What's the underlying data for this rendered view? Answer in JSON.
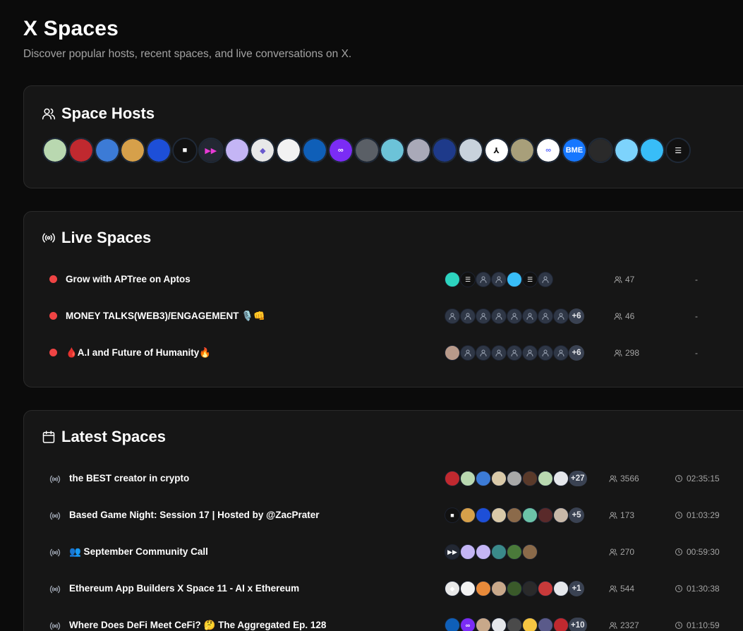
{
  "header": {
    "title": "X Spaces",
    "subtitle": "Discover popular hosts, recent spaces, and live conversations on X."
  },
  "hosts": {
    "title": "Space Hosts",
    "avatars": [
      {
        "bg": "#b9d8b0",
        "fg": "#4a3b2a",
        "glyph": ""
      },
      {
        "bg": "#c0292f",
        "fg": "#ffffff",
        "glyph": ""
      },
      {
        "bg": "#3c7bd6",
        "fg": "#f5c542",
        "glyph": ""
      },
      {
        "bg": "#d6a04a",
        "fg": "#3b2a1a",
        "glyph": ""
      },
      {
        "bg": "#1d4fd8",
        "fg": "#ffffff",
        "glyph": ""
      },
      {
        "bg": "#111111",
        "fg": "#ffffff",
        "glyph": "■"
      },
      {
        "bg": "#232833",
        "fg": "#e83ad6",
        "glyph": "▶▶"
      },
      {
        "bg": "#c4b5f5",
        "fg": "#5b3b1f",
        "glyph": ""
      },
      {
        "bg": "#e8e8e8",
        "fg": "#6a5acd",
        "glyph": "◆"
      },
      {
        "bg": "#f2f2f2",
        "fg": "#111111",
        "glyph": ""
      },
      {
        "bg": "#0f5fb8",
        "fg": "#ffffff",
        "glyph": ""
      },
      {
        "bg": "#7b2cf5",
        "fg": "#ffffff",
        "glyph": "∞"
      },
      {
        "bg": "#5a5f66",
        "fg": "#ffffff",
        "glyph": ""
      },
      {
        "bg": "#6cc3d8",
        "fg": "#2a2a2a",
        "glyph": ""
      },
      {
        "bg": "#a9a9b8",
        "fg": "#2a2a2a",
        "glyph": ""
      },
      {
        "bg": "#1e3a8a",
        "fg": "#ffffff",
        "glyph": ""
      },
      {
        "bg": "#c8d2dc",
        "fg": "#2a2a2a",
        "glyph": ""
      },
      {
        "bg": "#ffffff",
        "fg": "#111111",
        "glyph": "⅄"
      },
      {
        "bg": "#a89f7a",
        "fg": "#2a2a2a",
        "glyph": ""
      },
      {
        "bg": "#ffffff",
        "fg": "#5b6cff",
        "glyph": "∞"
      },
      {
        "bg": "#1677ff",
        "fg": "#ffffff",
        "glyph": "BME"
      },
      {
        "bg": "#2a2a2a",
        "fg": "#ffffff",
        "glyph": ""
      },
      {
        "bg": "#7dd3fc",
        "fg": "#111111",
        "glyph": ""
      },
      {
        "bg": "#38bdf8",
        "fg": "#16a34a",
        "glyph": ""
      },
      {
        "bg": "#111111",
        "fg": "#ffffff",
        "glyph": "☰"
      }
    ]
  },
  "live": {
    "title": "Live Spaces",
    "rows": [
      {
        "name": "Grow with APTree on Aptos",
        "listeners": "47",
        "duration": "-",
        "avatars": [
          {
            "bg": "#2dd4bf"
          },
          {
            "bg": "#111111",
            "glyph": "☰"
          },
          {
            "bg": ""
          },
          {
            "bg": ""
          },
          {
            "bg": "#38bdf8"
          },
          {
            "bg": "#111111",
            "glyph": "☰"
          },
          {
            "bg": ""
          }
        ],
        "more": ""
      },
      {
        "name": "MONEY TALKS(WEB3)/ENGAGEMENT 🎙️👊",
        "listeners": "46",
        "duration": "-",
        "avatars": [
          {
            "bg": ""
          },
          {
            "bg": ""
          },
          {
            "bg": ""
          },
          {
            "bg": ""
          },
          {
            "bg": ""
          },
          {
            "bg": ""
          },
          {
            "bg": ""
          },
          {
            "bg": ""
          }
        ],
        "more": "+6"
      },
      {
        "name": "🩸A.I and Future of Humanity🔥",
        "listeners": "298",
        "duration": "-",
        "avatars": [
          {
            "bg": "#b89a8a"
          },
          {
            "bg": ""
          },
          {
            "bg": ""
          },
          {
            "bg": ""
          },
          {
            "bg": ""
          },
          {
            "bg": ""
          },
          {
            "bg": ""
          },
          {
            "bg": ""
          }
        ],
        "more": "+6"
      }
    ]
  },
  "latest": {
    "title": "Latest Spaces",
    "rows": [
      {
        "name": "the BEST creator in crypto",
        "listeners": "3566",
        "duration": "02:35:15",
        "avatars": [
          {
            "bg": "#c0292f"
          },
          {
            "bg": "#b9d8b0"
          },
          {
            "bg": "#3c7bd6"
          },
          {
            "bg": "#d9c9a8"
          },
          {
            "bg": "#a8a8a8"
          },
          {
            "bg": "#5a3a2a"
          },
          {
            "bg": "#b9d8b0"
          },
          {
            "bg": "#e5e7eb"
          }
        ],
        "more": "+27"
      },
      {
        "name": "Based Game Night: Session 17 | Hosted by @ZacPrater",
        "listeners": "173",
        "duration": "01:03:29",
        "avatars": [
          {
            "bg": "#111111",
            "glyph": "■"
          },
          {
            "bg": "#d6a04a"
          },
          {
            "bg": "#1d4fd8"
          },
          {
            "bg": "#d9c9a8"
          },
          {
            "bg": "#8b6a4a"
          },
          {
            "bg": "#6cc3a8"
          },
          {
            "bg": "#5a2a2a"
          },
          {
            "bg": "#c8b8a8"
          }
        ],
        "more": "+5"
      },
      {
        "name": "👥 September Community Call",
        "listeners": "270",
        "duration": "00:59:30",
        "avatars": [
          {
            "bg": "#232833",
            "glyph": "▶▶"
          },
          {
            "bg": "#c4b5f5"
          },
          {
            "bg": "#c4b5f5"
          },
          {
            "bg": "#3a8a8a"
          },
          {
            "bg": "#4a7a3a"
          },
          {
            "bg": "#8a6a4a"
          }
        ],
        "more": ""
      },
      {
        "name": "Ethereum App Builders X Space 11 - AI x Ethereum",
        "listeners": "544",
        "duration": "01:30:38",
        "avatars": [
          {
            "bg": "#e8e8e8",
            "glyph": "◆"
          },
          {
            "bg": "#f2f2f2"
          },
          {
            "bg": "#e88a3a"
          },
          {
            "bg": "#c8a88a"
          },
          {
            "bg": "#3a5a2a"
          },
          {
            "bg": "#2a2a2a"
          },
          {
            "bg": "#c83a3a"
          },
          {
            "bg": "#e5e7eb"
          }
        ],
        "more": "+1"
      },
      {
        "name": "Where Does DeFi Meet CeFi? 🤔 The Aggregated Ep. 128",
        "listeners": "2327",
        "duration": "01:10:59",
        "avatars": [
          {
            "bg": "#0f5fb8"
          },
          {
            "bg": "#7b2cf5",
            "glyph": "∞"
          },
          {
            "bg": "#c8a88a"
          },
          {
            "bg": "#e5e7eb"
          },
          {
            "bg": "#4a4a4a"
          },
          {
            "bg": "#f5c542"
          },
          {
            "bg": "#5a5a8a"
          },
          {
            "bg": "#c0292f"
          }
        ],
        "more": "+10"
      }
    ]
  },
  "colors": {
    "background": "#0b0b0b",
    "card": "#161616",
    "live_dot": "#ef4444",
    "muted_text": "#a3a3a3"
  },
  "icons": {
    "hosts": "users-icon",
    "live": "broadcast-icon",
    "latest": "calendar-icon",
    "listeners": "users-icon",
    "duration": "clock-icon"
  }
}
